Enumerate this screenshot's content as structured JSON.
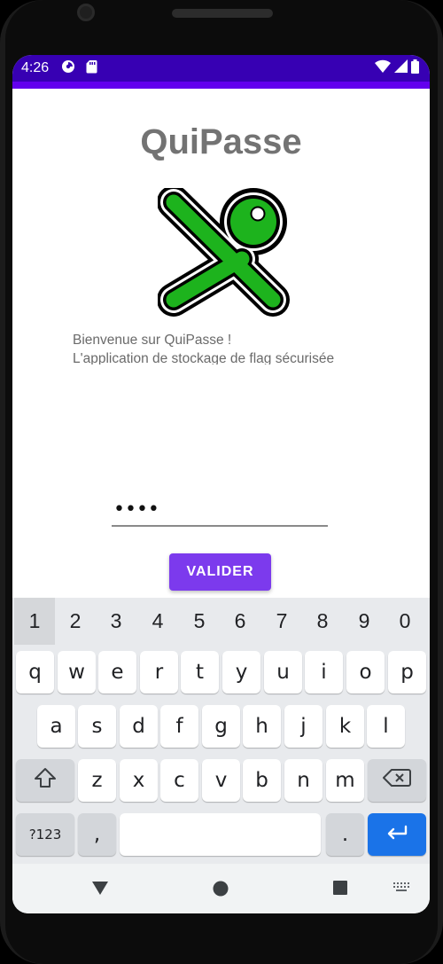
{
  "status_bar": {
    "time": "4:26",
    "icons": [
      "data-usage-icon",
      "sd-card-icon"
    ],
    "right_icons": [
      "wifi-icon",
      "signal-icon",
      "battery-icon"
    ]
  },
  "app": {
    "title": "QuiPasse",
    "logo_icon": "green-x-key-icon",
    "welcome_line1": "Bienvenue sur QuiPasse !",
    "welcome_line2": "L'application de stockage de flag sécurisée",
    "password_value": "••••",
    "validate_label": "VALIDER"
  },
  "keyboard": {
    "number_row": [
      "1",
      "2",
      "3",
      "4",
      "5",
      "6",
      "7",
      "8",
      "9",
      "0"
    ],
    "row1": [
      "q",
      "w",
      "e",
      "r",
      "t",
      "y",
      "u",
      "i",
      "o",
      "p"
    ],
    "row2": [
      "a",
      "s",
      "d",
      "f",
      "g",
      "h",
      "j",
      "k",
      "l"
    ],
    "row3": [
      "z",
      "x",
      "c",
      "v",
      "b",
      "n",
      "m"
    ],
    "symbols_label": "?123",
    "comma": ",",
    "period": "."
  },
  "nav_bar": {
    "icons": [
      "back-icon",
      "home-icon",
      "recents-icon",
      "keyboard-switch-icon"
    ]
  },
  "colors": {
    "status_bar": "#3700b3",
    "primary": "#6200ee",
    "button": "#7c3aed",
    "logo_green": "#1db31d",
    "enter_key": "#1a73e8"
  }
}
